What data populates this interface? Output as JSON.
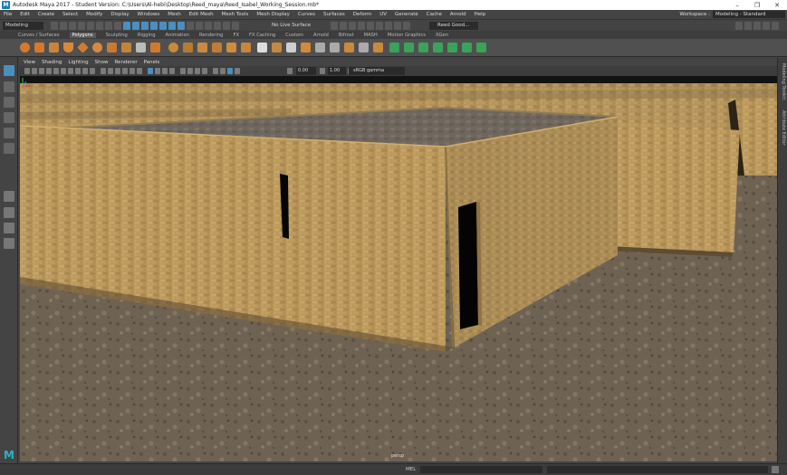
{
  "window": {
    "title": "Autodesk Maya 2017 - Student Version: C:\\Users\\Al-hebi\\Desktop\\Reed_maya\\Reed_Isabel_Working_Session.mb*",
    "logo": "M",
    "minimize": "–",
    "maximize": "❐",
    "close": "✕"
  },
  "menus": [
    "File",
    "Edit",
    "Create",
    "Select",
    "Modify",
    "Display",
    "Windows",
    "Mesh",
    "Edit Mesh",
    "Mesh Tools",
    "Mesh Display",
    "Curves",
    "Surfaces",
    "Deform",
    "UV",
    "Generate",
    "Cache",
    "Arnold",
    "Help"
  ],
  "workspace": {
    "label": "Workspace :",
    "value": "Modeling - Standard"
  },
  "status_line": {
    "mode": "Modeling",
    "live_surface": "No Live Surface",
    "reed_selector": "Reed Good..."
  },
  "shelf_tabs": [
    "Curves / Surfaces",
    "Polygons",
    "Sculpting",
    "Rigging",
    "Animation",
    "Rendering",
    "FX",
    "FX Caching",
    "Custom",
    "Arnold",
    "Bifrost",
    "MASH",
    "Motion Graphics",
    "XGen"
  ],
  "active_shelf_tab": "Polygons",
  "viewport_menu": [
    "View",
    "Shading",
    "Lighting",
    "Show",
    "Renderer",
    "Panels"
  ],
  "viewport_toolbar": {
    "field_a": "0.00",
    "field_b": "1.00",
    "colorspace": "sRGB gamma"
  },
  "viewport": {
    "camera_label": "persp"
  },
  "right_tabs": [
    "Modeling Toolkit",
    "Attribute Editor"
  ],
  "bottom": {
    "mel_label": "MEL"
  },
  "maya_logo": "M",
  "colors": {
    "accent": "#4a8fbf",
    "panel": "#444444",
    "wall": "#b8955a",
    "ground": "#726657"
  }
}
